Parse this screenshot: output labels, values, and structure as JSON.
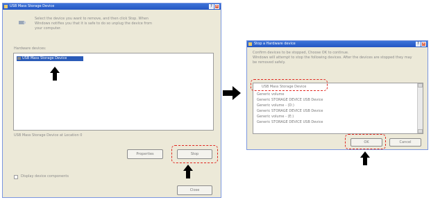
{
  "dialog1": {
    "title": "USB Mass Storage Device",
    "intro_line1": "Select the device you want to remove, and then click Stop. When",
    "intro_line2": "Windows notifies you that it is safe to do so unplug the device from",
    "intro_line3": "your computer.",
    "list_label": "Hardware devices:",
    "selected_item": "USB Mass Storage Device",
    "status_text": "USB Mass Storage Device at Location 0",
    "properties_label": "Properties",
    "stop_label": "Stop",
    "checkbox_label": "Display device components",
    "close_label": "Close"
  },
  "dialog2": {
    "title": "Stop a Hardware device",
    "line1": "Confirm devices to be stopped, Choose OK to continue.",
    "line2": "Windows will attempt to stop the following devices. After the devices are stopped they may",
    "line3": "be removed safely.",
    "items": [
      "USB Mass Storage Device",
      "Generic volume",
      "Generic STORAGE DEVICE USB Device",
      "Generic volume - (D:)",
      "Generic STORAGE DEVICE USB Device",
      "Generic volume - (E:)",
      "Generic STORAGE DEVICE USB Device"
    ],
    "ok_label": "OK",
    "cancel_label": "Cancel"
  },
  "colors": {
    "highlight": "#e0261f",
    "selection": "#2a5bb8",
    "titlebar": "#2456c3"
  }
}
